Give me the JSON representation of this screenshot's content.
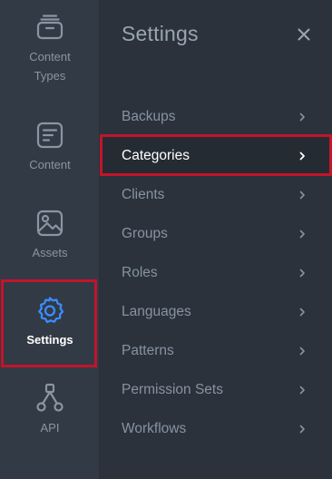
{
  "rail": {
    "items": [
      {
        "label_line1": "Content",
        "label_line2": "Types",
        "icon": "content-types-icon"
      },
      {
        "label": "Content",
        "icon": "content-icon"
      },
      {
        "label": "Assets",
        "icon": "image-icon"
      },
      {
        "label": "Settings",
        "icon": "gear-icon"
      },
      {
        "label": "API",
        "icon": "api-icon"
      }
    ],
    "active": "Settings"
  },
  "panel": {
    "title": "Settings",
    "close_icon": "close-icon",
    "items": [
      {
        "label": "Backups"
      },
      {
        "label": "Categories"
      },
      {
        "label": "Clients"
      },
      {
        "label": "Groups"
      },
      {
        "label": "Roles"
      },
      {
        "label": "Languages"
      },
      {
        "label": "Patterns"
      },
      {
        "label": "Permission Sets"
      },
      {
        "label": "Workflows"
      }
    ],
    "active": "Categories"
  },
  "colors": {
    "highlight": "#c3142b",
    "accent_blue": "#3b8cff",
    "rail_bg": "#323a45",
    "panel_bg": "#2b323c"
  }
}
